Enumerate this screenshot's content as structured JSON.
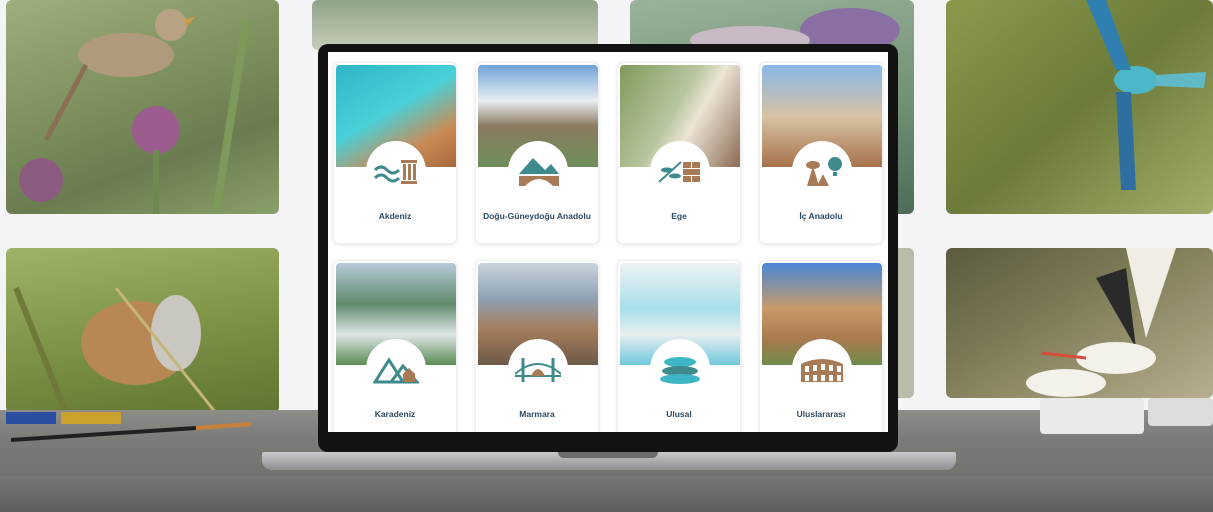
{
  "regions": [
    {
      "label": "Akdeniz",
      "icon": "columns-waves-icon"
    },
    {
      "label": "Doğu-Güneydoğu Anadolu",
      "icon": "mountain-bridge-icon"
    },
    {
      "label": "Ege",
      "icon": "olive-branch-icon"
    },
    {
      "label": "İç Anadolu",
      "icon": "fairy-chimney-balloon-icon"
    },
    {
      "label": "Karadeniz",
      "icon": "mountain-house-icon"
    },
    {
      "label": "Marmara",
      "icon": "bridge-mosque-icon"
    },
    {
      "label": "Ulusal",
      "icon": "travertine-pools-icon"
    },
    {
      "label": "Uluslararası",
      "icon": "colosseum-icon"
    }
  ],
  "colors": {
    "label_text": "#2b4a62",
    "icon_teal": "#3f8a8c",
    "icon_brown": "#a87a56"
  }
}
